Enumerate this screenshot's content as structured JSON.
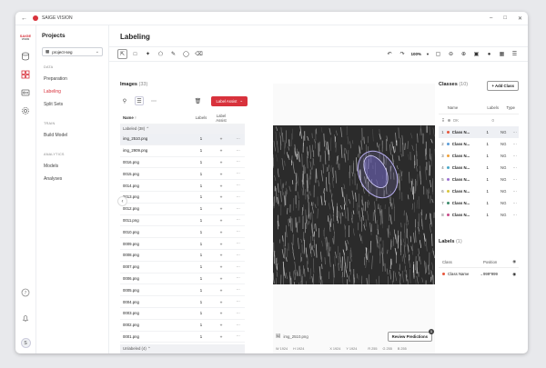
{
  "app": {
    "brand": "SAIGE VISION",
    "brand_line1": "SAIGE",
    "brand_line2": "VISION",
    "user_initial": "S"
  },
  "nav": {
    "title": "Projects",
    "project": "project-seg",
    "sections": [
      {
        "label": "DATA",
        "items": [
          "Preparation",
          "Labeling",
          "Split Sets"
        ]
      },
      {
        "label": "TRAIN",
        "items": [
          "Build Model"
        ]
      },
      {
        "label": "ANALYTICS",
        "items": [
          "Models",
          "Analyses"
        ]
      }
    ]
  },
  "page": {
    "title": "Labeling"
  },
  "toolbar": {
    "zoom": "100%"
  },
  "images": {
    "title": "Images",
    "count": "(33)",
    "label_assist": "Label Assist",
    "columns": {
      "name": "Name",
      "labels": "Labels",
      "assist": "Label Assist"
    },
    "labeled_group": "Labeled (38)",
    "unlabeled_group": "Unlabeled (4)",
    "rows": [
      {
        "name": "img_2510.png",
        "labels": "1"
      },
      {
        "name": "img_2909.png",
        "labels": "1"
      },
      {
        "name": "0016.png",
        "labels": "1"
      },
      {
        "name": "0015.png",
        "labels": "1"
      },
      {
        "name": "0014.png",
        "labels": "1"
      },
      {
        "name": "0013.png",
        "labels": "1"
      },
      {
        "name": "0012.png",
        "labels": "1"
      },
      {
        "name": "0011.png",
        "labels": "1"
      },
      {
        "name": "0010.png",
        "labels": "1"
      },
      {
        "name": "0009.png",
        "labels": "1"
      },
      {
        "name": "0008.png",
        "labels": "1"
      },
      {
        "name": "0007.png",
        "labels": "1"
      },
      {
        "name": "0006.png",
        "labels": "1"
      },
      {
        "name": "0005.png",
        "labels": "1"
      },
      {
        "name": "0004.png",
        "labels": "1"
      },
      {
        "name": "0003.png",
        "labels": "1"
      },
      {
        "name": "0002.png",
        "labels": "1"
      },
      {
        "name": "0001.png",
        "labels": "1"
      }
    ]
  },
  "viewer": {
    "filename": "img_2510.png",
    "review_label": "Review Predictions",
    "review_count": "1",
    "stats": [
      "W 1924",
      "H 1924",
      "X 1924",
      "Y 1924",
      "R 255",
      "G 255",
      "B 255"
    ]
  },
  "classes": {
    "title": "Classes",
    "count": "(10)",
    "add_label": "Add Class",
    "columns": {
      "name": "Name",
      "labels": "Labels",
      "type": "Type"
    },
    "ok": {
      "name": "OK",
      "labels": "0"
    },
    "rows": [
      {
        "n": "1",
        "name": "Class N...",
        "labels": "1",
        "type": "NG",
        "color": "#e8553a"
      },
      {
        "n": "2",
        "name": "Class N...",
        "labels": "1",
        "type": "NG",
        "color": "#5a9bd8"
      },
      {
        "n": "3",
        "name": "Class N...",
        "labels": "1",
        "type": "NG",
        "color": "#f0a13a"
      },
      {
        "n": "4",
        "name": "Class N...",
        "labels": "1",
        "type": "NG",
        "color": "#4aa8c8"
      },
      {
        "n": "5",
        "name": "Class N...",
        "labels": "1",
        "type": "NG",
        "color": "#9a6fd0"
      },
      {
        "n": "6",
        "name": "Class N...",
        "labels": "1",
        "type": "NG",
        "color": "#d8c63a"
      },
      {
        "n": "7",
        "name": "Class N...",
        "labels": "1",
        "type": "NG",
        "color": "#3a8a6a"
      },
      {
        "n": "8",
        "name": "Class N...",
        "labels": "1",
        "type": "NG",
        "color": "#c84a8a"
      }
    ]
  },
  "labels": {
    "title": "Labels",
    "count": "(1)",
    "columns": {
      "class": "Class",
      "position": "Position"
    },
    "rows": [
      {
        "class": "Class Name",
        "position": "999*999",
        "color": "#e8553a"
      }
    ]
  }
}
